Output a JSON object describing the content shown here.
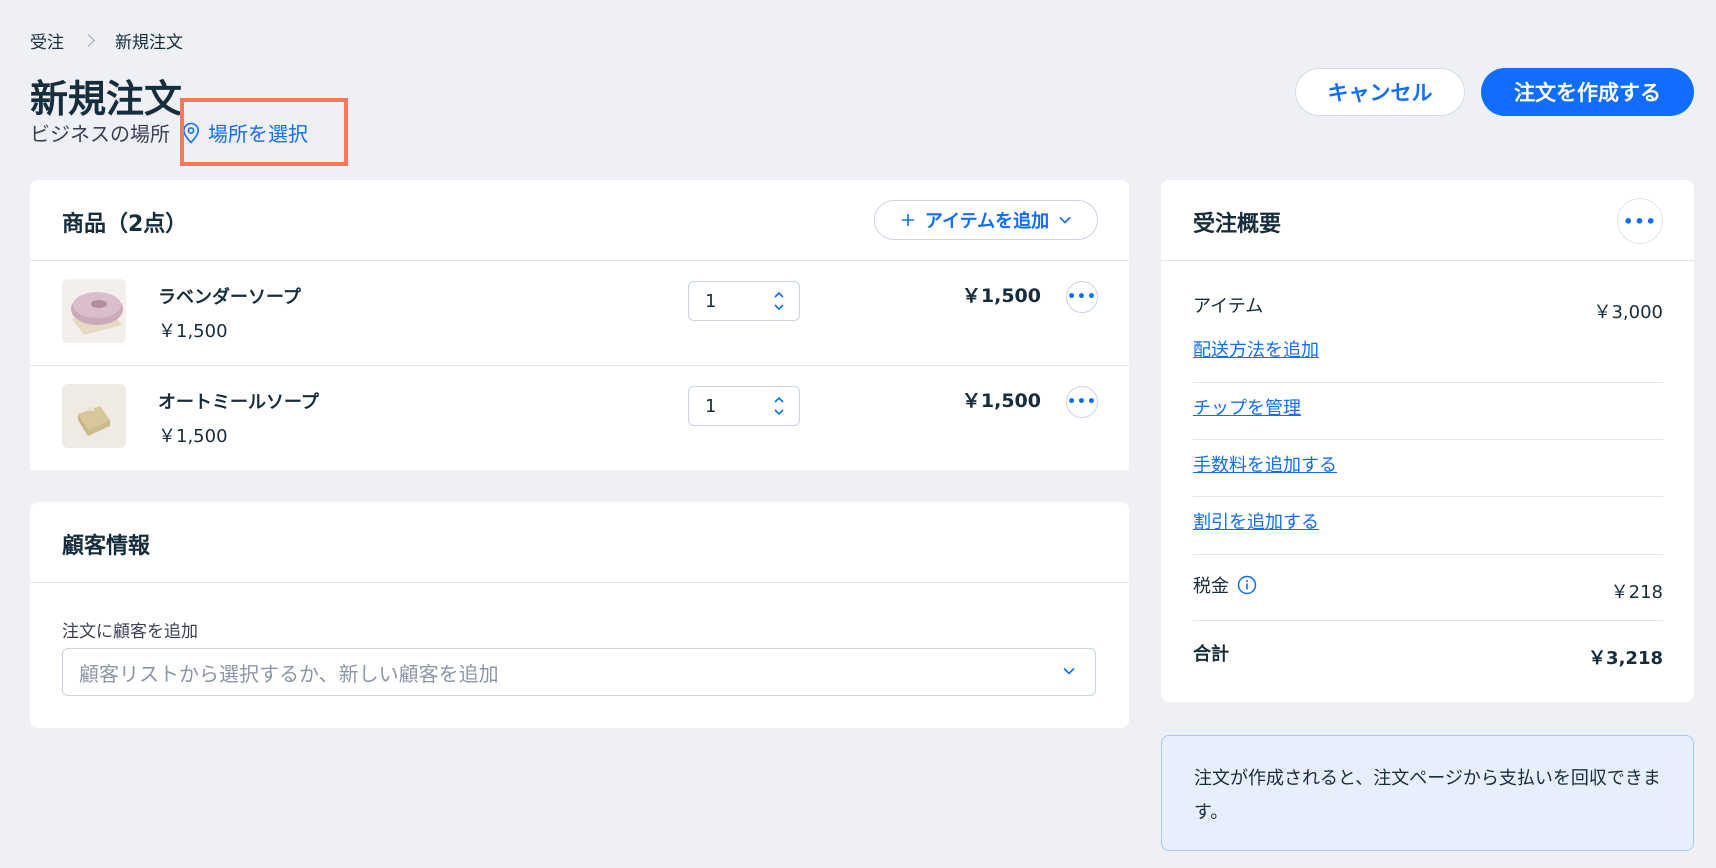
{
  "breadcrumb": {
    "parent": "受注",
    "current": "新規注文"
  },
  "page": {
    "title": "新規注文",
    "location_label": "ビジネスの場所",
    "location_link": "場所を選択"
  },
  "actions": {
    "cancel": "キャンセル",
    "create": "注文を作成する"
  },
  "products": {
    "title": "商品（2点）",
    "add_item": "アイテムを追加",
    "items": [
      {
        "name": "ラベンダーソープ",
        "unit_price": "￥1,500",
        "quantity": "1",
        "total": "￥1,500"
      },
      {
        "name": "オートミールソープ",
        "unit_price": "￥1,500",
        "quantity": "1",
        "total": "￥1,500"
      }
    ]
  },
  "customer": {
    "title": "顧客情報",
    "field_label": "注文に顧客を追加",
    "placeholder": "顧客リストから選択するか、新しい顧客を追加"
  },
  "summary": {
    "title": "受注概要",
    "items_label": "アイテム",
    "items_value": "￥3,000",
    "add_shipping": "配送方法を追加",
    "manage_tip": "チップを管理",
    "add_fee": "手数料を追加する",
    "add_discount": "割引を追加する",
    "tax_label": "税金",
    "tax_value": "￥218",
    "total_label": "合計",
    "total_value": "￥3,218"
  },
  "info_note": "注文が作成されると、注文ページから支払いを回収できます。",
  "colors": {
    "accent": "#116dff",
    "highlight": "#f7775c",
    "background": "#eef0f5"
  }
}
